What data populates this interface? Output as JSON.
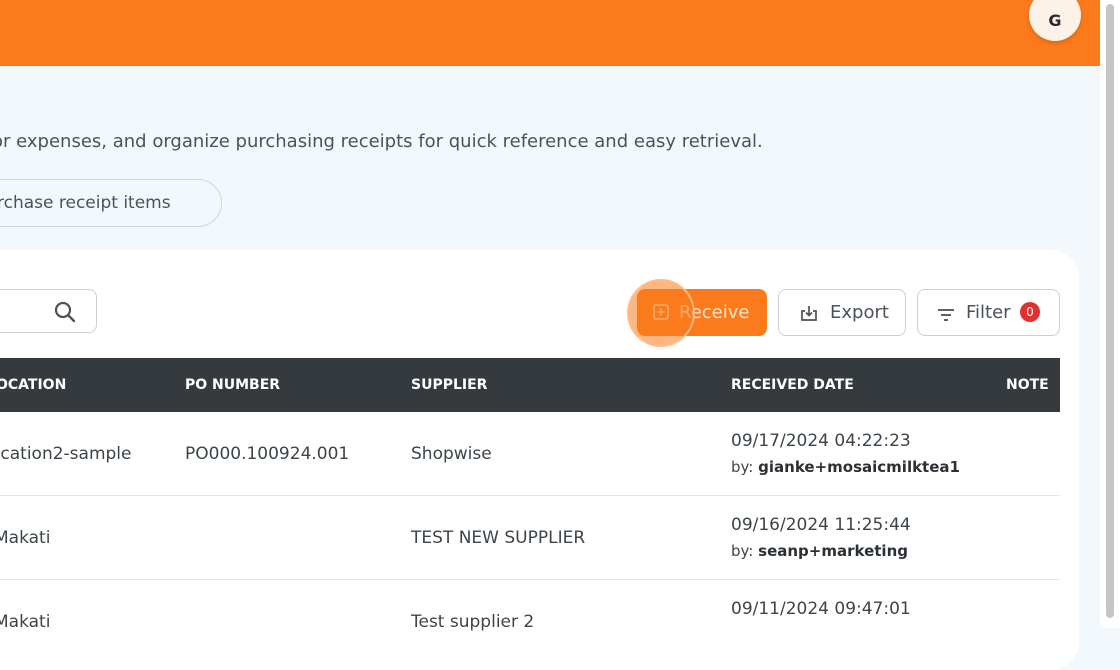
{
  "header": {
    "avatar_initial": "G"
  },
  "description": "or expenses, and organize purchasing receipts for quick reference and easy retrieval.",
  "tab": {
    "label": "rchase receipt items"
  },
  "toolbar": {
    "receive_label": "Receive",
    "export_label": "Export",
    "filter_label": "Filter",
    "filter_count": "0"
  },
  "table": {
    "columns": {
      "location": "OCATION",
      "po_number": "PO NUMBER",
      "supplier": "SUPPLIER",
      "received_date": "RECEIVED DATE",
      "note": "NOTE"
    },
    "rows": [
      {
        "location": "ocation2-sample",
        "po_number": "PO000.100924.001",
        "supplier": "Shopwise",
        "date": "09/17/2024 04:22:23",
        "by_prefix": "by:",
        "by_user": "gianke+mosaicmilktea1"
      },
      {
        "location": "Makati",
        "po_number": "",
        "supplier": "TEST NEW SUPPLIER",
        "date": "09/16/2024 11:25:44",
        "by_prefix": "by:",
        "by_user": "seanp+marketing"
      },
      {
        "location": "Makati",
        "po_number": "",
        "supplier": "Test supplier 2",
        "date": "09/11/2024 09:47:01",
        "by_prefix": "",
        "by_user": ""
      }
    ]
  },
  "colors": {
    "accent": "#fb7a1c",
    "header_dark": "#343a3e",
    "badge": "#e03131"
  }
}
